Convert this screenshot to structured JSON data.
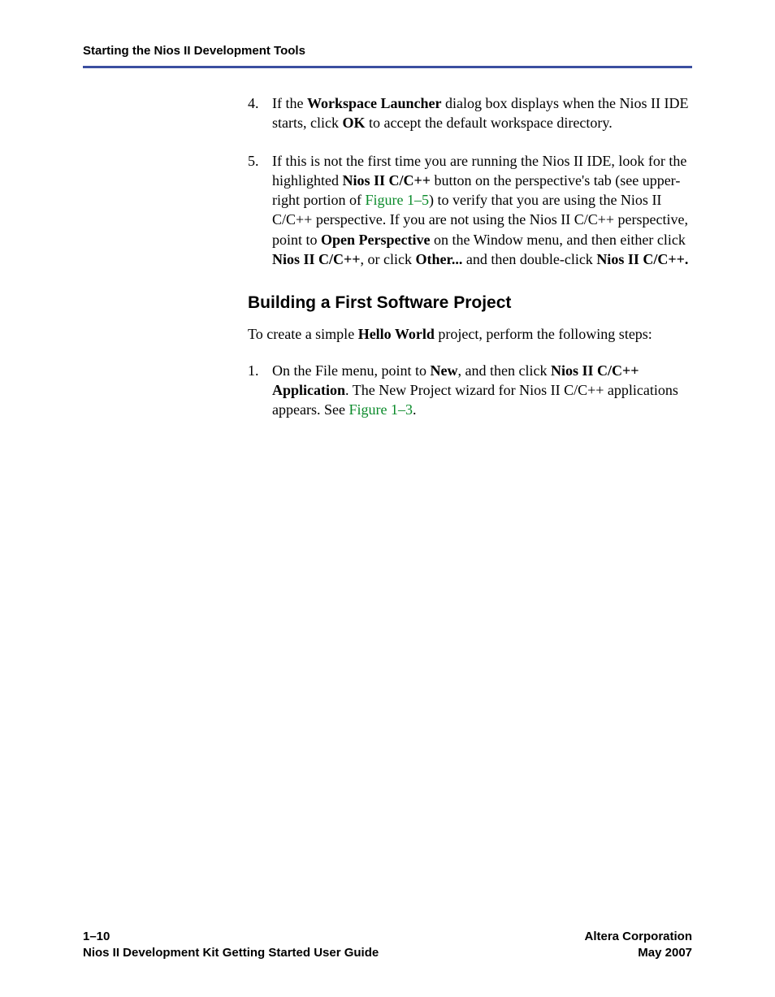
{
  "header": {
    "title": "Starting the Nios II Development Tools"
  },
  "step4": {
    "num": "4.",
    "t1": "If the ",
    "b1": "Workspace Launcher",
    "t2": " dialog box displays when the Nios II IDE starts, click ",
    "b2": "OK",
    "t3": " to accept the default workspace directory."
  },
  "step5": {
    "num": "5.",
    "t1": "If this is not the first time you are running the Nios II IDE, look for the highlighted ",
    "b1": "Nios II C/C++",
    "t2": " button on the perspective's tab (see upper-right portion of ",
    "link1": "Figure 1–5",
    "t3": ") to verify that you are using the Nios II C/C++ perspective. If you are not using the Nios II C/C++ perspective, point to ",
    "b2": "Open Perspective",
    "t4": " on the Window menu, and then either click ",
    "b3": "Nios II C/C++",
    "t5": ", or click ",
    "b4": "Other...",
    "t6": " and then double-click ",
    "b5": "Nios II C/C++."
  },
  "h2": "Building a First Software Project",
  "intro": {
    "t1": "To create a simple ",
    "b1": "Hello World",
    "t2": " project, perform the following steps:"
  },
  "step1": {
    "num": "1.",
    "t1": "On the File menu, point to ",
    "b1": "New",
    "t2": ", and then click ",
    "b2": "Nios II C/C++ Application",
    "t3": ". The New Project wizard for Nios II C/C++ applications appears. See ",
    "link1": "Figure 1–3",
    "t4": "."
  },
  "footer": {
    "left_line1": "1–10",
    "left_line2": "Nios II Development Kit Getting Started User Guide",
    "right_line1": "Altera Corporation",
    "right_line2": "May 2007"
  }
}
